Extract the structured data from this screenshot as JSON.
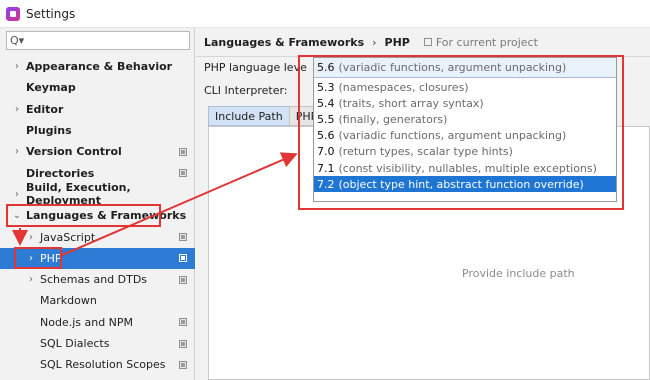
{
  "window": {
    "title": "Settings"
  },
  "sidebar": {
    "search_placeholder": "Q▾",
    "items": [
      {
        "label": "Appearance & Behavior",
        "bold": true,
        "expandable": true,
        "expanded": false,
        "depth": 0,
        "project_icon": false
      },
      {
        "label": "Keymap",
        "bold": true,
        "expandable": false,
        "depth": 0,
        "project_icon": false
      },
      {
        "label": "Editor",
        "bold": true,
        "expandable": true,
        "expanded": false,
        "depth": 0,
        "project_icon": false
      },
      {
        "label": "Plugins",
        "bold": true,
        "expandable": false,
        "depth": 0,
        "project_icon": false
      },
      {
        "label": "Version Control",
        "bold": true,
        "expandable": true,
        "expanded": false,
        "depth": 0,
        "project_icon": true
      },
      {
        "label": "Directories",
        "bold": true,
        "expandable": false,
        "depth": 0,
        "project_icon": true
      },
      {
        "label": "Build, Execution, Deployment",
        "bold": true,
        "expandable": true,
        "expanded": false,
        "depth": 0,
        "project_icon": false
      },
      {
        "label": "Languages & Frameworks",
        "bold": true,
        "expandable": true,
        "expanded": true,
        "depth": 0,
        "project_icon": false
      },
      {
        "label": "JavaScript",
        "bold": false,
        "expandable": true,
        "expanded": false,
        "depth": 1,
        "project_icon": true
      },
      {
        "label": "PHP",
        "bold": false,
        "expandable": true,
        "expanded": false,
        "depth": 1,
        "project_icon": true,
        "selected": true
      },
      {
        "label": "Schemas and DTDs",
        "bold": false,
        "expandable": true,
        "expanded": false,
        "depth": 1,
        "project_icon": true
      },
      {
        "label": "Markdown",
        "bold": false,
        "expandable": false,
        "depth": 1,
        "project_icon": false
      },
      {
        "label": "Node.js and NPM",
        "bold": false,
        "expandable": false,
        "depth": 1,
        "project_icon": true
      },
      {
        "label": "SQL Dialects",
        "bold": false,
        "expandable": false,
        "depth": 1,
        "project_icon": true
      },
      {
        "label": "SQL Resolution Scopes",
        "bold": false,
        "expandable": false,
        "depth": 1,
        "project_icon": true
      }
    ]
  },
  "main": {
    "breadcrumb": [
      "Languages & Frameworks",
      "PHP"
    ],
    "breadcrumb_separator": "›",
    "scope_label": "For current project",
    "php_language_level_label": "PHP language leve",
    "cli_interpreter_label": "CLI Interpreter:",
    "tabs": [
      {
        "label": "Include Path",
        "active": true
      },
      {
        "label": "PHP R",
        "active": false
      }
    ],
    "empty_text": "Provide include path"
  },
  "dropdown": {
    "selected": {
      "version": "5.6",
      "description": "(variadic functions, argument unpacking)"
    },
    "options": [
      {
        "version": "5.3",
        "description": "(namespaces, closures)",
        "highlighted": false
      },
      {
        "version": "5.4",
        "description": "(traits, short array syntax)",
        "highlighted": false
      },
      {
        "version": "5.5",
        "description": "(finally, generators)",
        "highlighted": false
      },
      {
        "version": "5.6",
        "description": "(variadic functions, argument unpacking)",
        "highlighted": false
      },
      {
        "version": "7.0",
        "description": "(return types, scalar type hints)",
        "highlighted": false
      },
      {
        "version": "7.1",
        "description": "(const visibility, nullables, multiple exceptions)",
        "highlighted": false
      },
      {
        "version": "7.2",
        "description": "(object type hint, abstract function override)",
        "highlighted": true
      }
    ]
  },
  "annotation_color": "#e23636",
  "selection_color": "#1e75d3"
}
